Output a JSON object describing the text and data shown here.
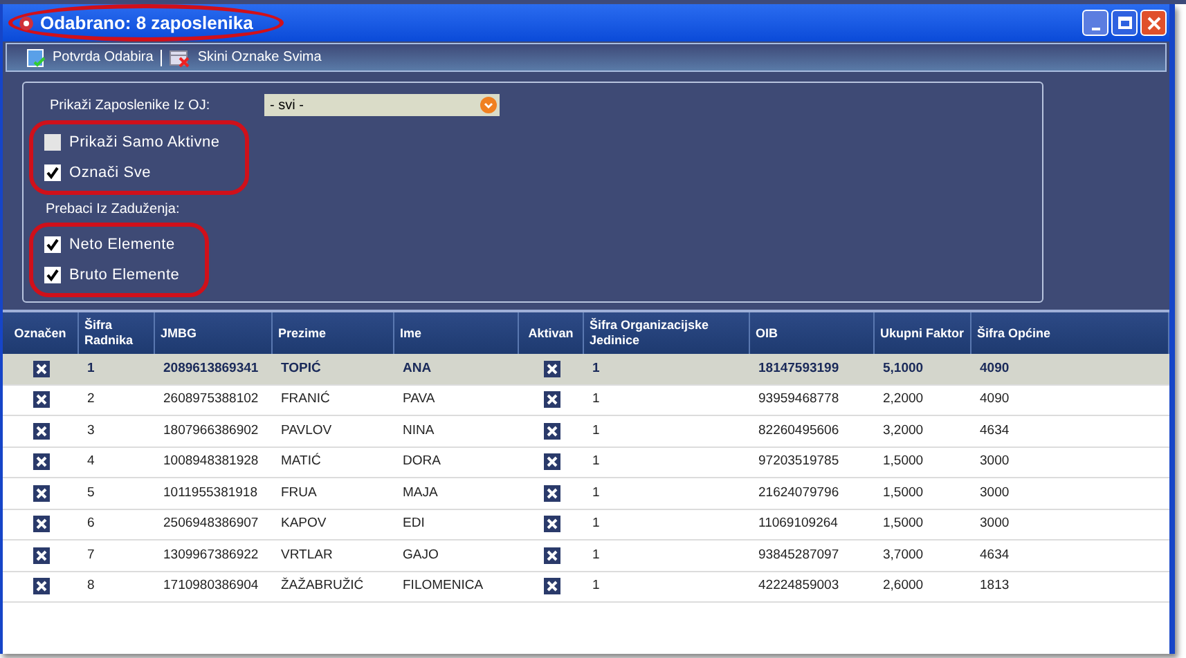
{
  "window": {
    "title": "Odabrano: 8 zaposlenika",
    "title_highlighted": true
  },
  "toolbar": [
    {
      "label": "Potvrda Odabira",
      "kind": "confirm"
    },
    {
      "label": "Skini Oznake Svima",
      "kind": "clear"
    }
  ],
  "filter": {
    "label": "Prikaži Zaposlenike Iz OJ:",
    "value": "- svi -"
  },
  "options": [
    {
      "highlighted": true,
      "items": [
        {
          "label": "Prikaži Samo Aktivne",
          "checked": false
        },
        {
          "label": "Označi Sve",
          "checked": true
        }
      ]
    }
  ],
  "transfer": {
    "label": "Prebaci Iz Zaduženja:",
    "highlighted": true,
    "items": [
      {
        "label": "Neto Elemente",
        "checked": true
      },
      {
        "label": "Bruto Elemente",
        "checked": true
      }
    ]
  },
  "table": {
    "columns": [
      "Označen",
      "Šifra Radnika",
      "JMBG",
      "Prezime",
      "Ime",
      "Aktivan",
      "Šifra Organizacijske Jedinice",
      "OIB",
      "Ukupni Faktor",
      "Šifra Općine"
    ],
    "rows": [
      {
        "selected": true,
        "cells": [
          {
            "kind": "check",
            "checked": true
          },
          {
            "kind": "text",
            "text": "1"
          },
          {
            "kind": "text",
            "text": "2089613869341"
          },
          {
            "kind": "text",
            "text": "TOPIĆ"
          },
          {
            "kind": "text",
            "text": "ANA"
          },
          {
            "kind": "check",
            "checked": true
          },
          {
            "kind": "text",
            "text": "1"
          },
          {
            "kind": "text",
            "text": "18147593199"
          },
          {
            "kind": "text",
            "text": "5,1000"
          },
          {
            "kind": "text",
            "text": "4090"
          }
        ]
      },
      {
        "selected": false,
        "cells": [
          {
            "kind": "check",
            "checked": true
          },
          {
            "kind": "text",
            "text": "2"
          },
          {
            "kind": "text",
            "text": "2608975388102"
          },
          {
            "kind": "text",
            "text": "FRANIĆ"
          },
          {
            "kind": "text",
            "text": "PAVA"
          },
          {
            "kind": "check",
            "checked": true
          },
          {
            "kind": "text",
            "text": "1"
          },
          {
            "kind": "text",
            "text": "93959468778"
          },
          {
            "kind": "text",
            "text": "2,2000"
          },
          {
            "kind": "text",
            "text": "4090"
          }
        ]
      },
      {
        "selected": false,
        "cells": [
          {
            "kind": "check",
            "checked": true
          },
          {
            "kind": "text",
            "text": "3"
          },
          {
            "kind": "text",
            "text": "1807966386902"
          },
          {
            "kind": "text",
            "text": "PAVLOV"
          },
          {
            "kind": "text",
            "text": "NINA"
          },
          {
            "kind": "check",
            "checked": true
          },
          {
            "kind": "text",
            "text": "1"
          },
          {
            "kind": "text",
            "text": "82260495606"
          },
          {
            "kind": "text",
            "text": "3,2000"
          },
          {
            "kind": "text",
            "text": "4634"
          }
        ]
      },
      {
        "selected": false,
        "cells": [
          {
            "kind": "check",
            "checked": true
          },
          {
            "kind": "text",
            "text": "4"
          },
          {
            "kind": "text",
            "text": "1008948381928"
          },
          {
            "kind": "text",
            "text": "MATIĆ"
          },
          {
            "kind": "text",
            "text": "DORA"
          },
          {
            "kind": "check",
            "checked": true
          },
          {
            "kind": "text",
            "text": "1"
          },
          {
            "kind": "text",
            "text": "97203519785"
          },
          {
            "kind": "text",
            "text": "1,5000"
          },
          {
            "kind": "text",
            "text": "3000"
          }
        ]
      },
      {
        "selected": false,
        "cells": [
          {
            "kind": "check",
            "checked": true
          },
          {
            "kind": "text",
            "text": "5"
          },
          {
            "kind": "text",
            "text": "1011955381918"
          },
          {
            "kind": "text",
            "text": "FRUA"
          },
          {
            "kind": "text",
            "text": "MAJA"
          },
          {
            "kind": "check",
            "checked": true
          },
          {
            "kind": "text",
            "text": "1"
          },
          {
            "kind": "text",
            "text": "21624079796"
          },
          {
            "kind": "text",
            "text": "1,5000"
          },
          {
            "kind": "text",
            "text": "3000"
          }
        ]
      },
      {
        "selected": false,
        "cells": [
          {
            "kind": "check",
            "checked": true
          },
          {
            "kind": "text",
            "text": "6"
          },
          {
            "kind": "text",
            "text": "2506948386907"
          },
          {
            "kind": "text",
            "text": "KAPOV"
          },
          {
            "kind": "text",
            "text": "EDI"
          },
          {
            "kind": "check",
            "checked": true
          },
          {
            "kind": "text",
            "text": "1"
          },
          {
            "kind": "text",
            "text": "11069109264"
          },
          {
            "kind": "text",
            "text": "1,5000"
          },
          {
            "kind": "text",
            "text": "3000"
          }
        ]
      },
      {
        "selected": false,
        "cells": [
          {
            "kind": "check",
            "checked": true
          },
          {
            "kind": "text",
            "text": "7"
          },
          {
            "kind": "text",
            "text": "1309967386922"
          },
          {
            "kind": "text",
            "text": "VRTLAR"
          },
          {
            "kind": "text",
            "text": "GAJO"
          },
          {
            "kind": "check",
            "checked": true
          },
          {
            "kind": "text",
            "text": "1"
          },
          {
            "kind": "text",
            "text": "93845287097"
          },
          {
            "kind": "text",
            "text": "3,7000"
          },
          {
            "kind": "text",
            "text": "4634"
          }
        ]
      },
      {
        "selected": false,
        "cells": [
          {
            "kind": "check",
            "checked": true
          },
          {
            "kind": "text",
            "text": "8"
          },
          {
            "kind": "text",
            "text": "1710980386904"
          },
          {
            "kind": "text",
            "text": "ŽAŽABRUŽIĆ"
          },
          {
            "kind": "text",
            "text": "FILOMENICA"
          },
          {
            "kind": "check",
            "checked": true
          },
          {
            "kind": "text",
            "text": "1"
          },
          {
            "kind": "text",
            "text": "42224859003"
          },
          {
            "kind": "text",
            "text": "2,6000"
          },
          {
            "kind": "text",
            "text": "1813"
          }
        ]
      }
    ]
  }
}
